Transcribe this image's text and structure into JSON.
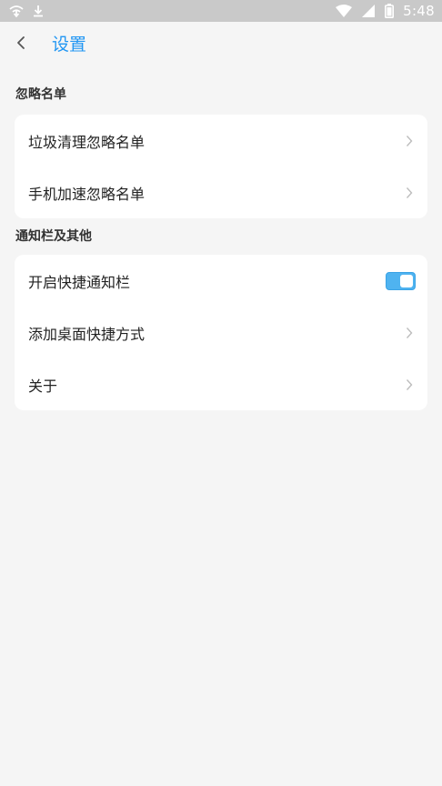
{
  "status_bar": {
    "time": "5:48",
    "icons": [
      "wifi-assist-icon",
      "download-icon",
      "wifi-icon",
      "cellular-signal-icon",
      "battery-icon"
    ]
  },
  "header": {
    "back_icon": "chevron-left-icon",
    "title": "设置"
  },
  "sections": [
    {
      "title": "忽略名单",
      "items": [
        {
          "label": "垃圾清理忽略名单",
          "control": "chevron"
        },
        {
          "label": "手机加速忽略名单",
          "control": "chevron"
        }
      ]
    },
    {
      "title": "通知栏及其他",
      "items": [
        {
          "label": "开启快捷通知栏",
          "control": "toggle",
          "enabled": true
        },
        {
          "label": "添加桌面快捷方式",
          "control": "chevron"
        },
        {
          "label": "关于",
          "control": "chevron"
        }
      ]
    }
  ],
  "colors": {
    "accent": "#2196f3",
    "toggle_on": "#4fb3f0",
    "background": "#f5f5f5",
    "card": "#ffffff",
    "status_bar": "#c9c9c9"
  }
}
